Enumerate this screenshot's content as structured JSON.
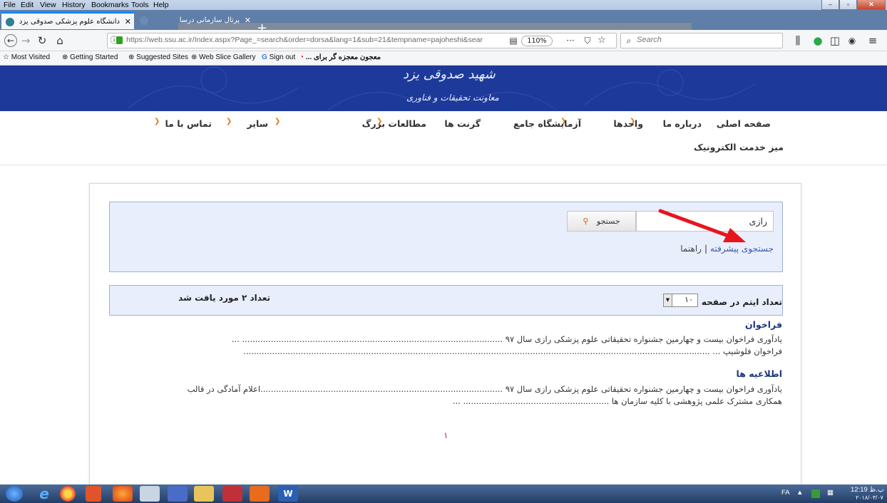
{
  "browser": {
    "menu": [
      "File",
      "Edit",
      "View",
      "History",
      "Bookmarks",
      "Tools",
      "Help"
    ],
    "tabs": [
      {
        "title": "دانشگاه علوم پزشکی صدوقی یزد",
        "active": true
      },
      {
        "title": "پرتال سازمانی درسا",
        "active": false
      }
    ],
    "url": "https://web.ssu.ac.ir/Index.aspx?Page_=search&order=dorsa&lang=1&sub=21&tempname=pajoheshi&sear",
    "url_domain": "ssu.ac.ir",
    "zoom": "110%",
    "search_placeholder": "Search",
    "bookmarks": [
      "Most Visited",
      "Getting Started",
      "Suggested Sites",
      "Web Slice Gallery",
      "Sign out",
      "معجون معجزه گر برای ..."
    ]
  },
  "header": {
    "banner_text_line1": "شهید صدوقی یزد",
    "banner_text_line2": "معاونت تحقیقات و فناوری"
  },
  "nav": {
    "items": [
      "صفحه اصلی",
      "درباره ما",
      "واحدها",
      "آزمایشگاه جامع",
      "گرنت ها",
      "مطالعات بزرگ",
      "سایر",
      "تماس با ما"
    ],
    "second_row": "میز خدمت الکترونیک"
  },
  "search": {
    "query": "رازی",
    "button_label": "جستجو",
    "advanced_link": "جستجوی پیشرفته",
    "help_link": "راهنما",
    "separator": "|"
  },
  "results_bar": {
    "items_per_page_label": "تعداد ایتم در صفحه",
    "items_per_page_value": "۱۰",
    "count_label": "تعداد ۲ مورد یافت شد"
  },
  "results": [
    {
      "heading": "فراخوان",
      "lines": [
        "یادآوری فراخوان بیست و چهارمین جشنواره تحقیقاتی علوم پزشکی رازی سال ۹۷ .................................................................................................... ...",
        "فراخوان فلوشیپ ... ..................................................................................................................................................................................."
      ]
    },
    {
      "heading": "اطلاعیه ها",
      "lines": [
        "یادآوری فراخوان بیست و چهارمین جشنواره تحقیقاتی علوم پزشکی رازی سال ۹۷ .............................................................................................اعلام آمادگی در قالب",
        "همکاری مشترک علمی پژوهشی با کلیه سازمان ها ........................................................ ..."
      ]
    }
  ],
  "pagination": {
    "current": "۱"
  },
  "taskbar": {
    "lang": "FA",
    "time": "12:19",
    "ampm": "ب.ظ",
    "date": "۲۰۱۸/۰۳/۰۷"
  },
  "colors": {
    "banner": "#1d3a9a",
    "menu_chevron": "#e07a17",
    "link": "#3d5aa8",
    "box_bg": "#e8eefb",
    "arrow": "#e8141c"
  }
}
